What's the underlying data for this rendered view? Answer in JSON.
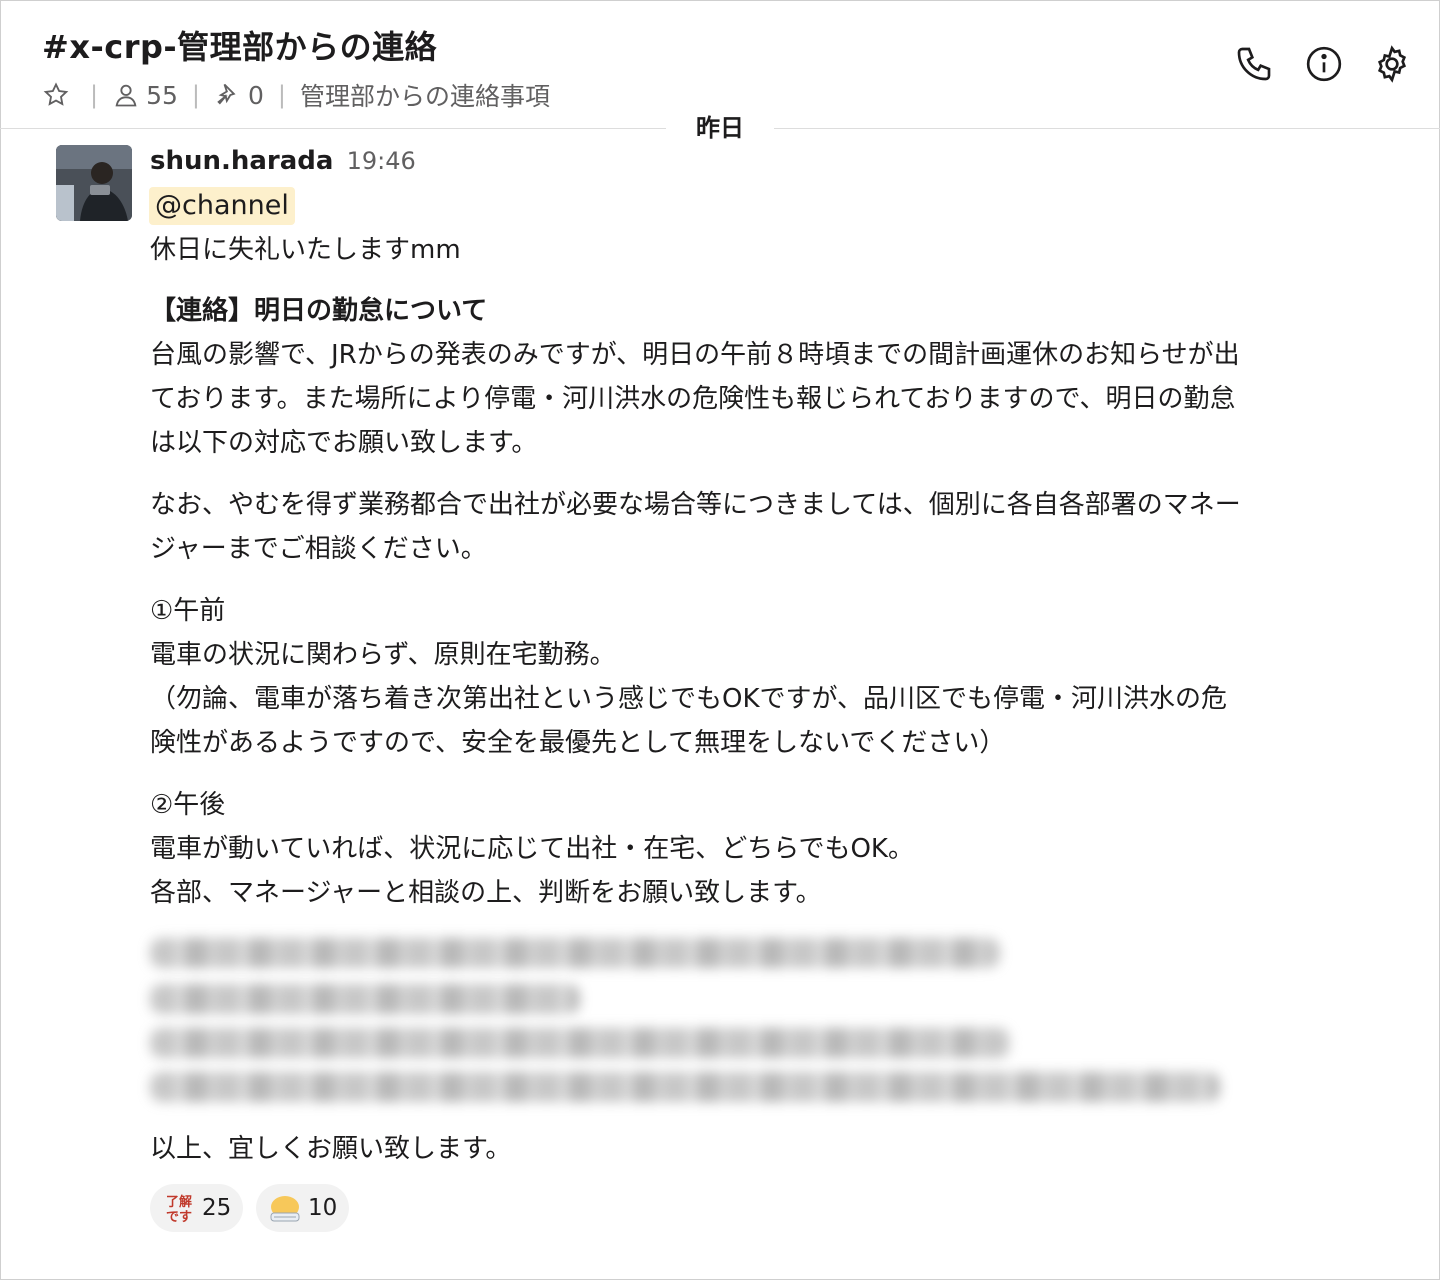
{
  "channel": {
    "title": "#x-crp-管理部からの連絡",
    "members": "55",
    "pins": "0",
    "topic": "管理部からの連絡事項"
  },
  "divider": {
    "date": "昨日"
  },
  "message": {
    "author": "shun.harada",
    "time": "19:46",
    "mention": "@channel",
    "lines": [
      "休日に失礼いたしますmm",
      "【連絡】明日の勤怠について",
      "台風の影響で、JRからの発表のみですが、明日の午前８時頃までの間計画運休のお知らせが出",
      "ております。また場所により停電・河川洪水の危険性も報じられておりますので、明日の勤怠",
      "は以下の対応でお願い致します。",
      "なお、やむを得ず業務都合で出社が必要な場合等につきましては、個別に各自各部署のマネー",
      "ジャーまでご相談ください。",
      "①午前",
      "電車の状況に関わらず、原則在宅勤務。",
      "（勿論、電車が落ち着き次第出社という感じでもOKですが、品川区でも停電・河川洪水の危",
      "険性があるようですので、安全を最優先として無理をしないでください）",
      "②午後",
      "電車が動いていれば、状況に応じて出社・在宅、どちらでもOK。",
      "各部、マネージャーと相談の上、判断をお願い致します。",
      "以上、宜しくお願い致します。"
    ],
    "reactions": [
      {
        "emoji": "了解です",
        "count": "25"
      },
      {
        "emoji": "bow-emoji",
        "count": "10"
      }
    ]
  }
}
